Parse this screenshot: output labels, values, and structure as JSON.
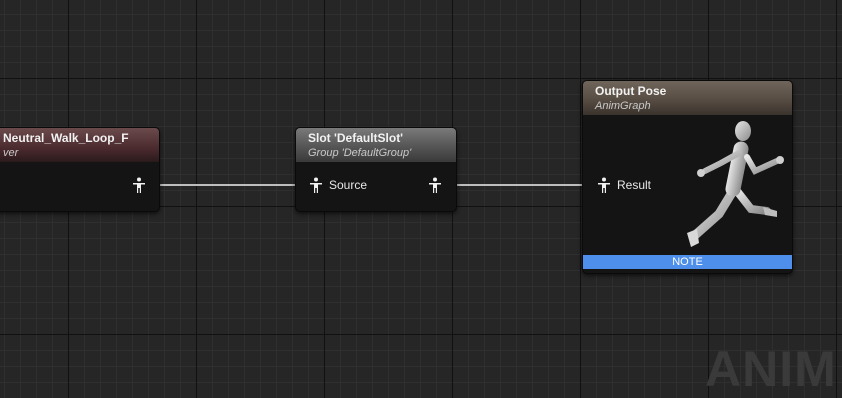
{
  "nodes": {
    "play": {
      "title": "Neutral_Walk_Loop_F",
      "subtitle": "ver"
    },
    "slot": {
      "title": "Slot 'DefaultSlot'",
      "subtitle": "Group 'DefaultGroup'",
      "input_pin": "Source"
    },
    "output": {
      "title": "Output Pose",
      "subtitle": "AnimGraph",
      "input_pin": "Result",
      "note": "NOTE"
    }
  },
  "watermark": "ANIM",
  "colors": {
    "note": "#4d8fea",
    "wire": "#c8c8c8",
    "background": "#262626"
  },
  "icons": {
    "pin": "pose-pin-icon",
    "preview": "running-mannequin-icon"
  }
}
